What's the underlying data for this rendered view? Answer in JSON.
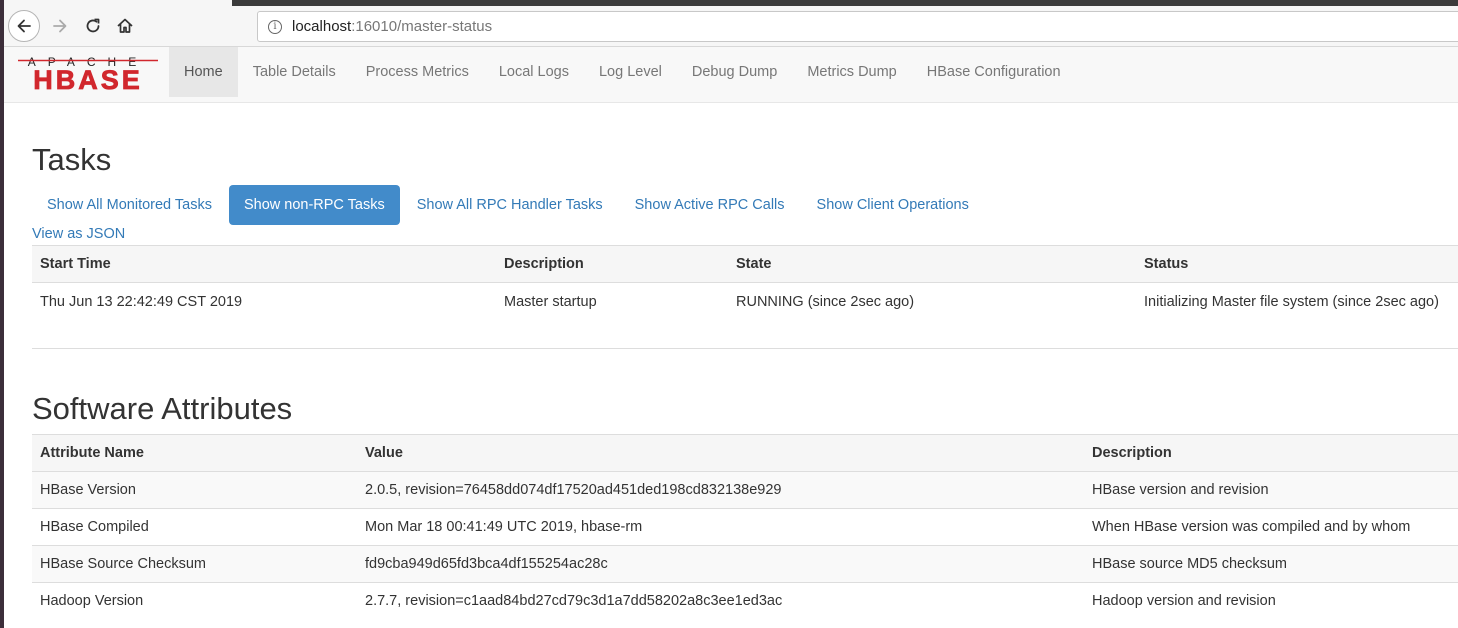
{
  "browser": {
    "url_host": "localhost",
    "url_rest": ":16010/master-status"
  },
  "logo": {
    "top_text": "APACHE",
    "main_text": "HBASE",
    "color": "#d1272d"
  },
  "nav": {
    "items": [
      {
        "label": "Home",
        "active": true
      },
      {
        "label": "Table Details"
      },
      {
        "label": "Process Metrics"
      },
      {
        "label": "Local Logs"
      },
      {
        "label": "Log Level"
      },
      {
        "label": "Debug Dump"
      },
      {
        "label": "Metrics Dump"
      },
      {
        "label": "HBase Configuration"
      }
    ]
  },
  "tasks": {
    "title": "Tasks",
    "pills": [
      {
        "label": "Show All Monitored Tasks"
      },
      {
        "label": "Show non-RPC Tasks",
        "active": true
      },
      {
        "label": "Show All RPC Handler Tasks"
      },
      {
        "label": "Show Active RPC Calls"
      },
      {
        "label": "Show Client Operations"
      }
    ],
    "json_link": "View as JSON",
    "headers": [
      "Start Time",
      "Description",
      "State",
      "Status"
    ],
    "rows": [
      [
        "Thu Jun 13 22:42:49 CST 2019",
        "Master startup",
        "RUNNING (since 2sec ago)",
        "Initializing Master file system (since 2sec ago)"
      ]
    ]
  },
  "software": {
    "title": "Software Attributes",
    "headers": [
      "Attribute Name",
      "Value",
      "Description"
    ],
    "rows": [
      [
        "HBase Version",
        "2.0.5, revision=76458dd074df17520ad451ded198cd832138e929",
        "HBase version and revision"
      ],
      [
        "HBase Compiled",
        "Mon Mar 18 00:41:49 UTC 2019, hbase-rm",
        "When HBase version was compiled and by whom"
      ],
      [
        "HBase Source Checksum",
        "fd9cba949d65fd3bca4df155254ac28c",
        "HBase source MD5 checksum"
      ],
      [
        "Hadoop Version",
        "2.7.7, revision=c1aad84bd27cd79c3d1a7dd58202a8c3ee1ed3ac",
        "Hadoop version and revision"
      ]
    ]
  }
}
